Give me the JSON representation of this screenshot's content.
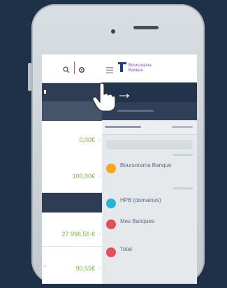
{
  "colors": {
    "background": "#1f3049",
    "nav_dark": "#22334c",
    "amount_green": "#7cb342",
    "dot_orange": "#f5a623",
    "dot_blue": "#2bb0d8",
    "dot_red": "#e0505a"
  },
  "left_panel": {
    "amounts": [
      "0,00€",
      "100,00€",
      "27 996,56 €",
      "90,55€"
    ]
  },
  "right_panel": {
    "logo_text": "Boursorama Banque",
    "menu_items": [
      {
        "title": "Boursorama Banque",
        "color_key": "dot_orange"
      },
      {
        "title": "HPB (domaines)",
        "color_key": "dot_blue"
      },
      {
        "title": "Mes Banques",
        "color_key": "dot_red"
      },
      {
        "title": "Total",
        "color_key": "dot_red"
      }
    ]
  },
  "icons": {
    "search": "search-icon",
    "settings": "gear-icon",
    "menu": "hamburger-icon",
    "pointer": "hand-pointer-icon",
    "swipe": "right-arrow-icon"
  }
}
